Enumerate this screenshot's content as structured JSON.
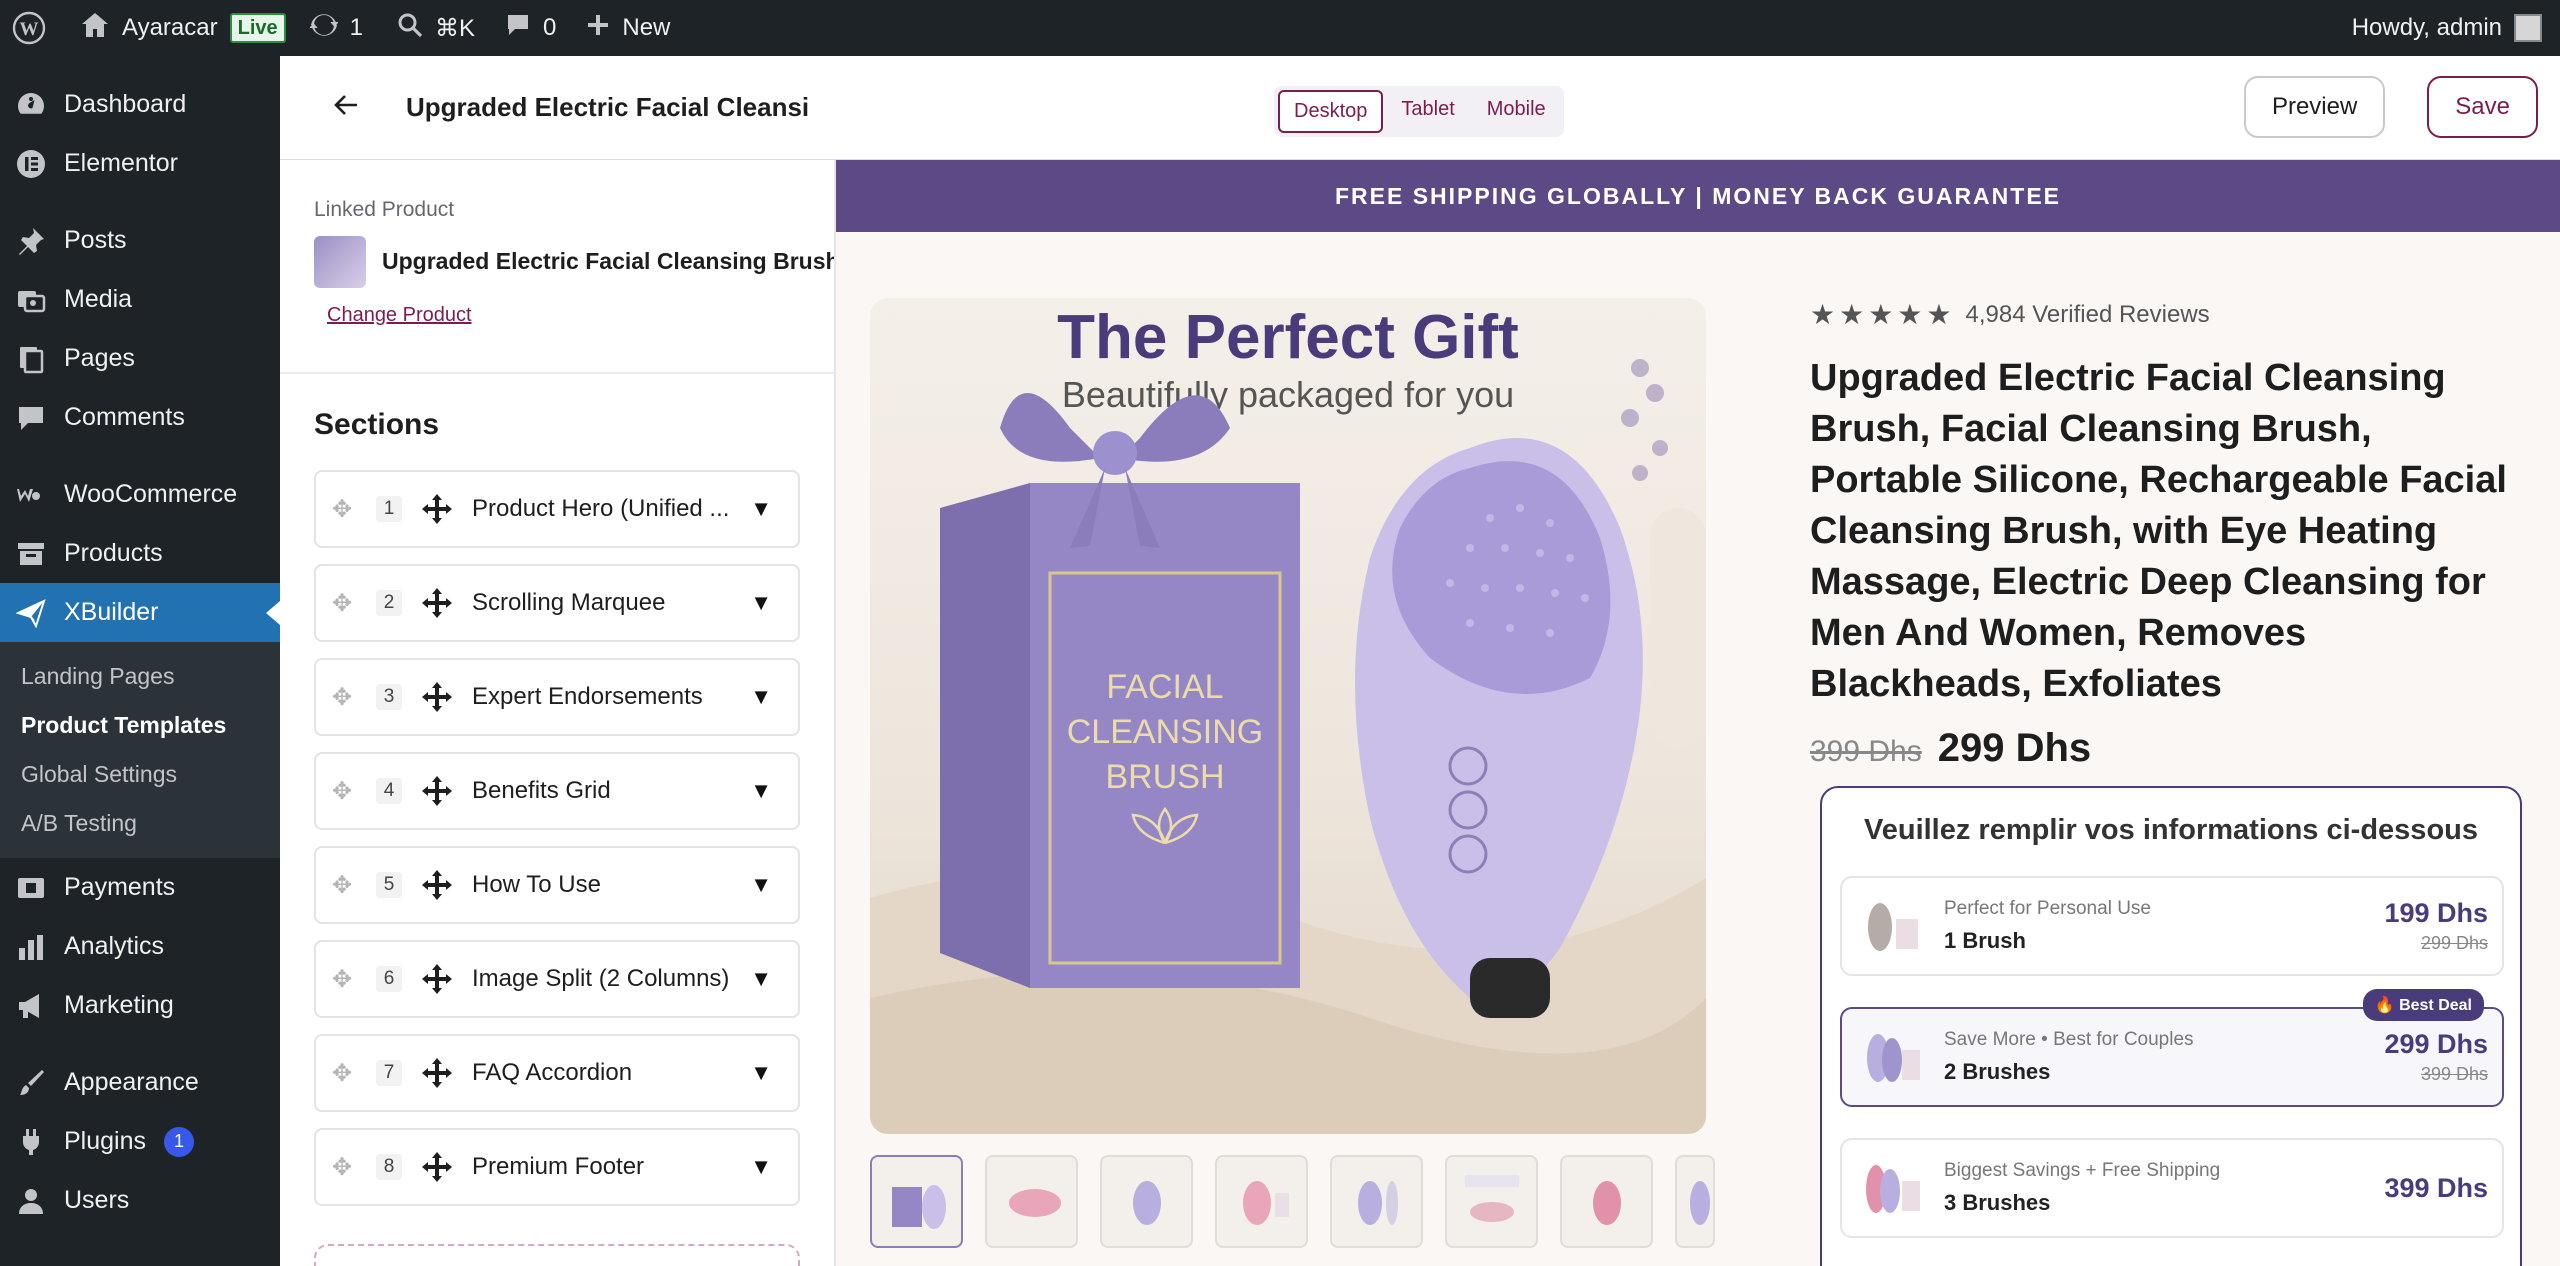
{
  "adminbar": {
    "site_name": "Ayaracar",
    "live_label": "Live",
    "updates_count": "1",
    "search_shortcut": "⌘K",
    "comments_count": "0",
    "new_label": "New",
    "howdy": "Howdy, admin"
  },
  "wp_menu": {
    "items_top": [
      {
        "label": "Dashboard",
        "icon": "dashboard-icon"
      },
      {
        "label": "Elementor",
        "icon": "elementor-icon"
      }
    ],
    "items_content": [
      {
        "label": "Posts",
        "icon": "pin-icon"
      },
      {
        "label": "Media",
        "icon": "media-icon"
      },
      {
        "label": "Pages",
        "icon": "pages-icon"
      },
      {
        "label": "Comments",
        "icon": "comment-icon"
      }
    ],
    "woocommerce": "WooCommerce",
    "products": "Products",
    "xbuilder": "XBuilder",
    "submenu": [
      "Landing Pages",
      "Product Templates",
      "Global Settings",
      "A/B Testing"
    ],
    "payments": "Payments",
    "analytics": "Analytics",
    "marketing": "Marketing",
    "appearance": "Appearance",
    "plugins": "Plugins",
    "plugins_badge": "1",
    "users": "Users"
  },
  "topbar": {
    "title": "Upgraded Electric Facial Cleansi",
    "devices": [
      "Desktop",
      "Tablet",
      "Mobile"
    ],
    "active_device": "Desktop",
    "preview_label": "Preview",
    "save_label": "Save"
  },
  "panel": {
    "linked_label": "Linked Product",
    "product_name": "Upgraded Electric Facial Cleansing Brush",
    "change_label": "Change Product",
    "sections_heading": "Sections",
    "sections": [
      {
        "num": "1",
        "name": "Product Hero (Unified ..."
      },
      {
        "num": "2",
        "name": "Scrolling Marquee"
      },
      {
        "num": "3",
        "name": "Expert Endorsements"
      },
      {
        "num": "4",
        "name": "Benefits Grid"
      },
      {
        "num": "5",
        "name": "How To Use"
      },
      {
        "num": "6",
        "name": "Image Split (2 Columns)"
      },
      {
        "num": "7",
        "name": "FAQ Accordion"
      },
      {
        "num": "8",
        "name": "Premium Footer"
      }
    ]
  },
  "preview": {
    "promo": "FREE SHIPPING GLOBALLY | MONEY BACK GUARANTEE",
    "image_title": "The Perfect Gift",
    "image_subtitle": "Beautifully packaged for you",
    "box_text": [
      "FACIAL",
      "CLEANSING",
      "BRUSH"
    ],
    "reviews": "4,984 Verified Reviews",
    "product_title": "Upgraded Electric Facial Cleansing Brush, Facial Cleansing Brush, Portable Silicone, Rechargeable Facial Cleansing Brush, with Eye Heating Massage, Electric Deep Cleansing for Men And Women, Removes Blackheads, Exfoliates",
    "old_price": "399 Dhs",
    "new_price": "299 Dhs",
    "form_title": "Veuillez remplir vos informations ci-dessous",
    "options": [
      {
        "sub": "Perfect for Personal Use",
        "main": "1 Brush",
        "price": "199 Dhs",
        "old": "299 Dhs",
        "badge": ""
      },
      {
        "sub": "Save More • Best for Couples",
        "main": "2 Brushes",
        "price": "299 Dhs",
        "old": "399 Dhs",
        "badge": "🔥 Best Deal"
      },
      {
        "sub": "Biggest Savings + Free Shipping",
        "main": "3 Brushes",
        "price": "399 Dhs",
        "old": "",
        "badge": ""
      }
    ]
  },
  "colors": {
    "admin_bg": "#1d2327",
    "accent": "#7b1d4f",
    "brand_purple": "#5b4a86",
    "wp_blue": "#2271b1"
  }
}
